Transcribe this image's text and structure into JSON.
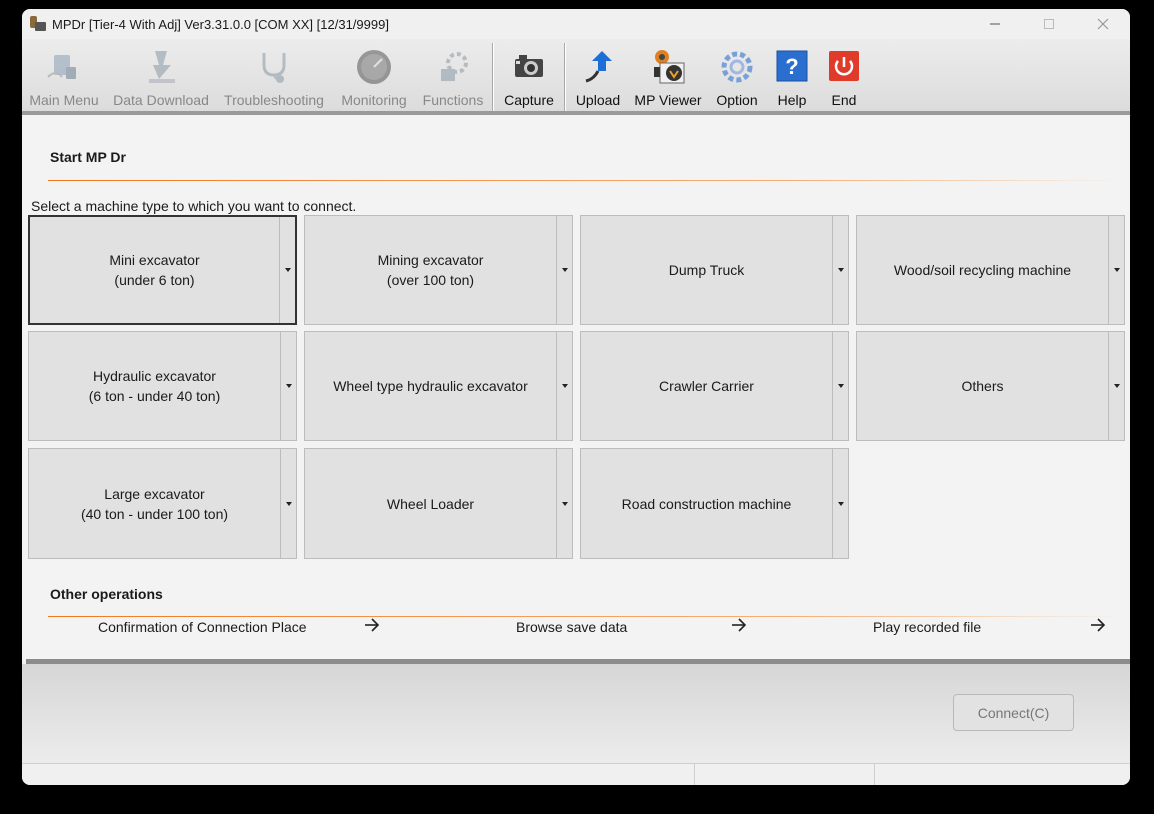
{
  "window": {
    "title": "MPDr [Tier-4 With Adj] Ver3.31.0.0 [COM XX] [12/31/9999]"
  },
  "toolbar": {
    "items": [
      {
        "label": "Main Menu",
        "icon": "main-menu-icon",
        "enabled": false
      },
      {
        "label": "Data Download",
        "icon": "download-icon",
        "enabled": false
      },
      {
        "label": "Troubleshooting",
        "icon": "stethoscope-icon",
        "enabled": false
      },
      {
        "label": "Monitoring",
        "icon": "gauge-icon",
        "enabled": false
      },
      {
        "label": "Functions",
        "icon": "functions-icon",
        "enabled": false
      },
      {
        "label": "Capture",
        "icon": "camera-icon",
        "enabled": true
      },
      {
        "label": "Upload",
        "icon": "upload-icon",
        "enabled": true
      },
      {
        "label": "MP Viewer",
        "icon": "mp-viewer-icon",
        "enabled": true
      },
      {
        "label": "Option",
        "icon": "gear-icon",
        "enabled": true
      },
      {
        "label": "Help",
        "icon": "help-icon",
        "enabled": true
      },
      {
        "label": "End",
        "icon": "power-icon",
        "enabled": true
      }
    ]
  },
  "start": {
    "title": "Start MP Dr",
    "prompt": "Select a machine type to which you want to connect.",
    "machines": [
      {
        "line1": "Mini excavator",
        "line2": "(under 6 ton)",
        "selected": true
      },
      {
        "line1": "Mining excavator",
        "line2": "(over 100 ton)"
      },
      {
        "line1": "Dump Truck",
        "line2": ""
      },
      {
        "line1": "Wood/soil recycling machine",
        "line2": ""
      },
      {
        "line1": "Hydraulic excavator",
        "line2": "(6 ton - under 40 ton)"
      },
      {
        "line1": "Wheel type hydraulic excavator",
        "line2": ""
      },
      {
        "line1": "Crawler Carrier",
        "line2": ""
      },
      {
        "line1": "Others",
        "line2": ""
      },
      {
        "line1": "Large excavator",
        "line2": "(40 ton - under 100 ton)"
      },
      {
        "line1": "Wheel Loader",
        "line2": ""
      },
      {
        "line1": "Road construction machine",
        "line2": ""
      }
    ]
  },
  "other": {
    "title": "Other operations",
    "links": [
      {
        "label": "Confirmation of Connection Place"
      },
      {
        "label": "Browse save data"
      },
      {
        "label": "Play recorded file"
      }
    ]
  },
  "footer": {
    "connect_label": "Connect(C)"
  },
  "colors": {
    "accent_line": "#f07820",
    "end_button": "#e03a2a",
    "help_button": "#2a6fd0"
  }
}
